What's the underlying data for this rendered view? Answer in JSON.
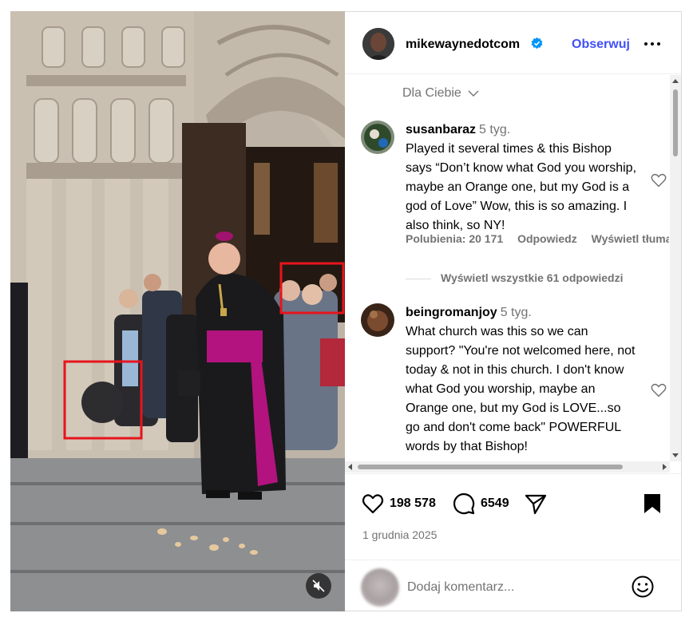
{
  "video": {
    "mute_icon": "speaker-muted-icon",
    "highlight_color": "#e8141c"
  },
  "header": {
    "username": "mikewaynedotcom",
    "verified": true,
    "follow_label": "Obserwuj",
    "more_icon": "more-horizontal-icon"
  },
  "comments": {
    "sort_label": "Dla Ciebie",
    "items": [
      {
        "user": "susanbaraz",
        "time": "5 tyg.",
        "text": "Played it several times & this Bishop says “Don’t know what God you worship, maybe an Orange one, but my God is a god of Love” Wow, this is so amazing. I also think, so NY!",
        "likes": "Polubienia: 20 171",
        "reply": "Odpowiedz",
        "translate": "Wyświetl tłumaczenie"
      },
      {
        "user": "beingromanjoy",
        "time": "5 tyg.",
        "text": "What church was this so we can support? \"You're not welcomed here, not today & not in this church. I don't know what God you worship, maybe an Orange one, but my God is LOVE...so go and don't come back\" POWERFUL words by that Bishop!"
      }
    ],
    "view_replies": "Wyświetl wszystkie 61 odpowiedzi"
  },
  "actions": {
    "likes": "198 578",
    "comments": "6549",
    "date": "1 grudnia 2025"
  },
  "add_comment": {
    "placeholder": "Dodaj komentarz..."
  },
  "colors": {
    "accent": "#4150f7",
    "verified": "#0095f6",
    "muted_text": "#737373"
  }
}
